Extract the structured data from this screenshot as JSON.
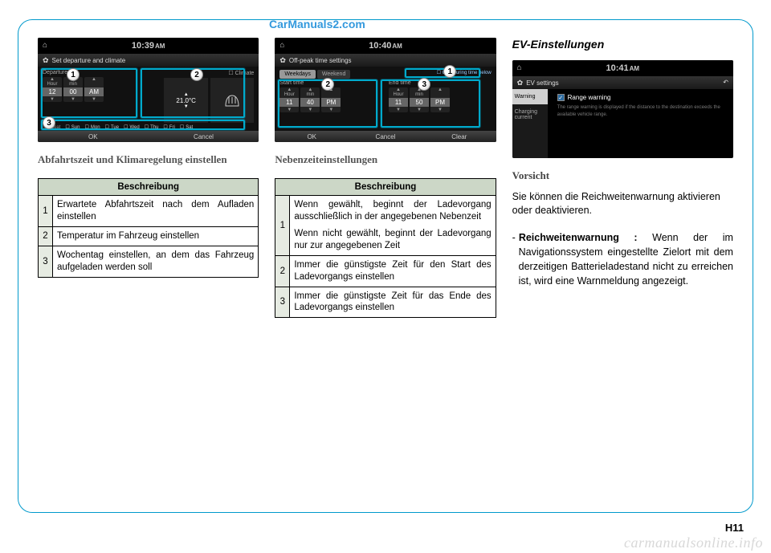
{
  "watermark_center": "CarManuals2.com",
  "footer_page": "H11",
  "footer_site": "carmanualsonline.info",
  "col1": {
    "shot": {
      "time": "10:39",
      "ampm": "AM",
      "title": "Set departure and climate",
      "hour": "12",
      "min": "00",
      "ampm2": "AM",
      "temp": "21.0°C",
      "climate_label": "Climate",
      "dep_label": "Departure ti",
      "repeat_label": "epeat",
      "days": [
        "Sun",
        "Mon",
        "Tue",
        "Wed",
        "Thu",
        "Fri",
        "Sat"
      ],
      "btn_ok": "OK",
      "btn_cancel": "Cancel"
    },
    "caption": "Abfahrtszeit und Klimaregelung einstellen",
    "table_header": "Beschreibung",
    "rows": [
      {
        "n": "1",
        "t": "Erwartete Abfahrtszeit nach dem Aufladen einstellen"
      },
      {
        "n": "2",
        "t": "Temperatur im Fahrzeug einstellen"
      },
      {
        "n": "3",
        "t": "Wochentag einstellen, an dem das Fahrzeug aufgeladen werden soll"
      }
    ]
  },
  "col2": {
    "shot": {
      "time": "10:40",
      "ampm": "AM",
      "title": "Off-peak time settings",
      "tab_wd": "Weekdays",
      "tab_we": "Weekend",
      "only_label": "Only during time below",
      "start_label": "Start time",
      "end_label": "End time",
      "s_hour": "11",
      "s_min": "40",
      "s_ap": "PM",
      "e_hour": "11",
      "e_min": "50",
      "e_ap": "PM",
      "btn_ok": "OK",
      "btn_cancel": "Cancel",
      "btn_clear": "Clear"
    },
    "caption": "Nebenzeiteinstellungen",
    "table_header": "Beschreibung",
    "rows": [
      {
        "n": "1",
        "t": "Wenn gewählt, beginnt der Ladevorgang ausschließlich in der angegebenen Nebenzeit",
        "t2": "Wenn nicht gewählt, beginnt der Ladevorgang nur zur angegebenen Zeit"
      },
      {
        "n": "2",
        "t": "Immer die günstigste Zeit für den Start des Ladevorgangs einstellen"
      },
      {
        "n": "3",
        "t": "Immer die günstigste Zeit für das Ende des Ladevorgangs einstellen"
      }
    ]
  },
  "col3": {
    "heading": "EV-Einstellungen",
    "shot": {
      "time": "10:41",
      "ampm": "AM",
      "title": "EV settings",
      "side_warning": "Warning",
      "side_charging": "Charging current",
      "check_label": "Range warning",
      "desc": "The range warning is displayed if the distance to the destination exceeds the available vehicle range."
    },
    "subhead": "Vorsicht",
    "para": "Sie können die Reichweitenwarnung aktivieren oder deaktivieren.",
    "bullet_bold": "Reichweitenwarnung :",
    "bullet_text": "Wenn der im Navigationssystem eingestellte Zielort mit dem derzeitigen Batterieladestand nicht zu erreichen ist, wird eine Warnmeldung angezeigt."
  }
}
